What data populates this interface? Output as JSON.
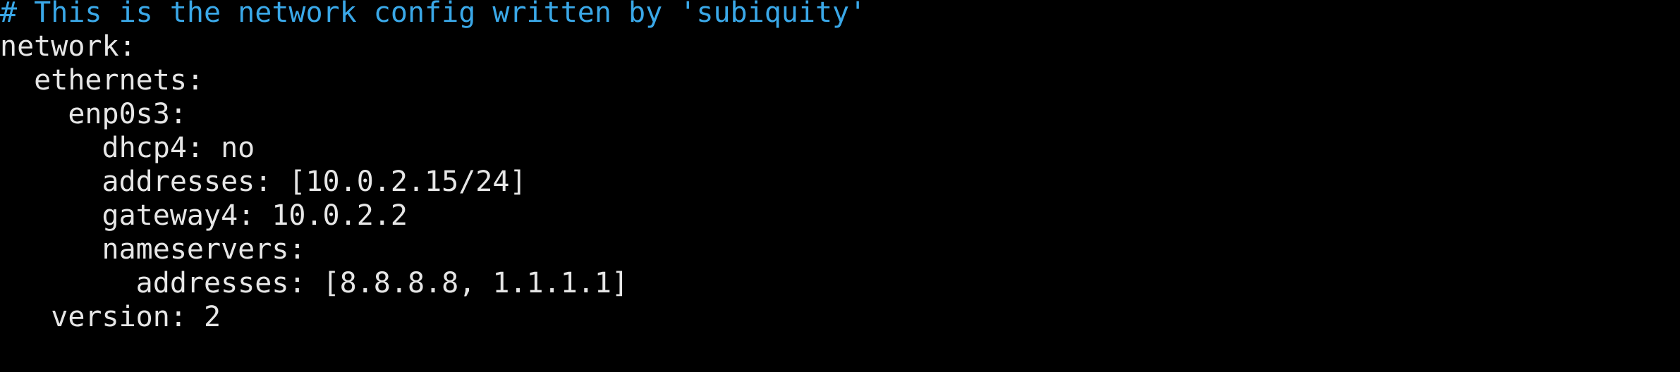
{
  "colors": {
    "background": "#000000",
    "text": "#e6e6e6",
    "comment": "#3aa8e8"
  },
  "lines": [
    "# This is the network config written by 'subiquity'",
    "network:",
    "  ethernets:",
    "    enp0s3:",
    "      dhcp4: no",
    "      addresses: [10.0.2.15/24]",
    "      gateway4: 10.0.2.2",
    "      nameservers:",
    "        addresses: [8.8.8.8, 1.1.1.1]",
    "   version: 2"
  ]
}
